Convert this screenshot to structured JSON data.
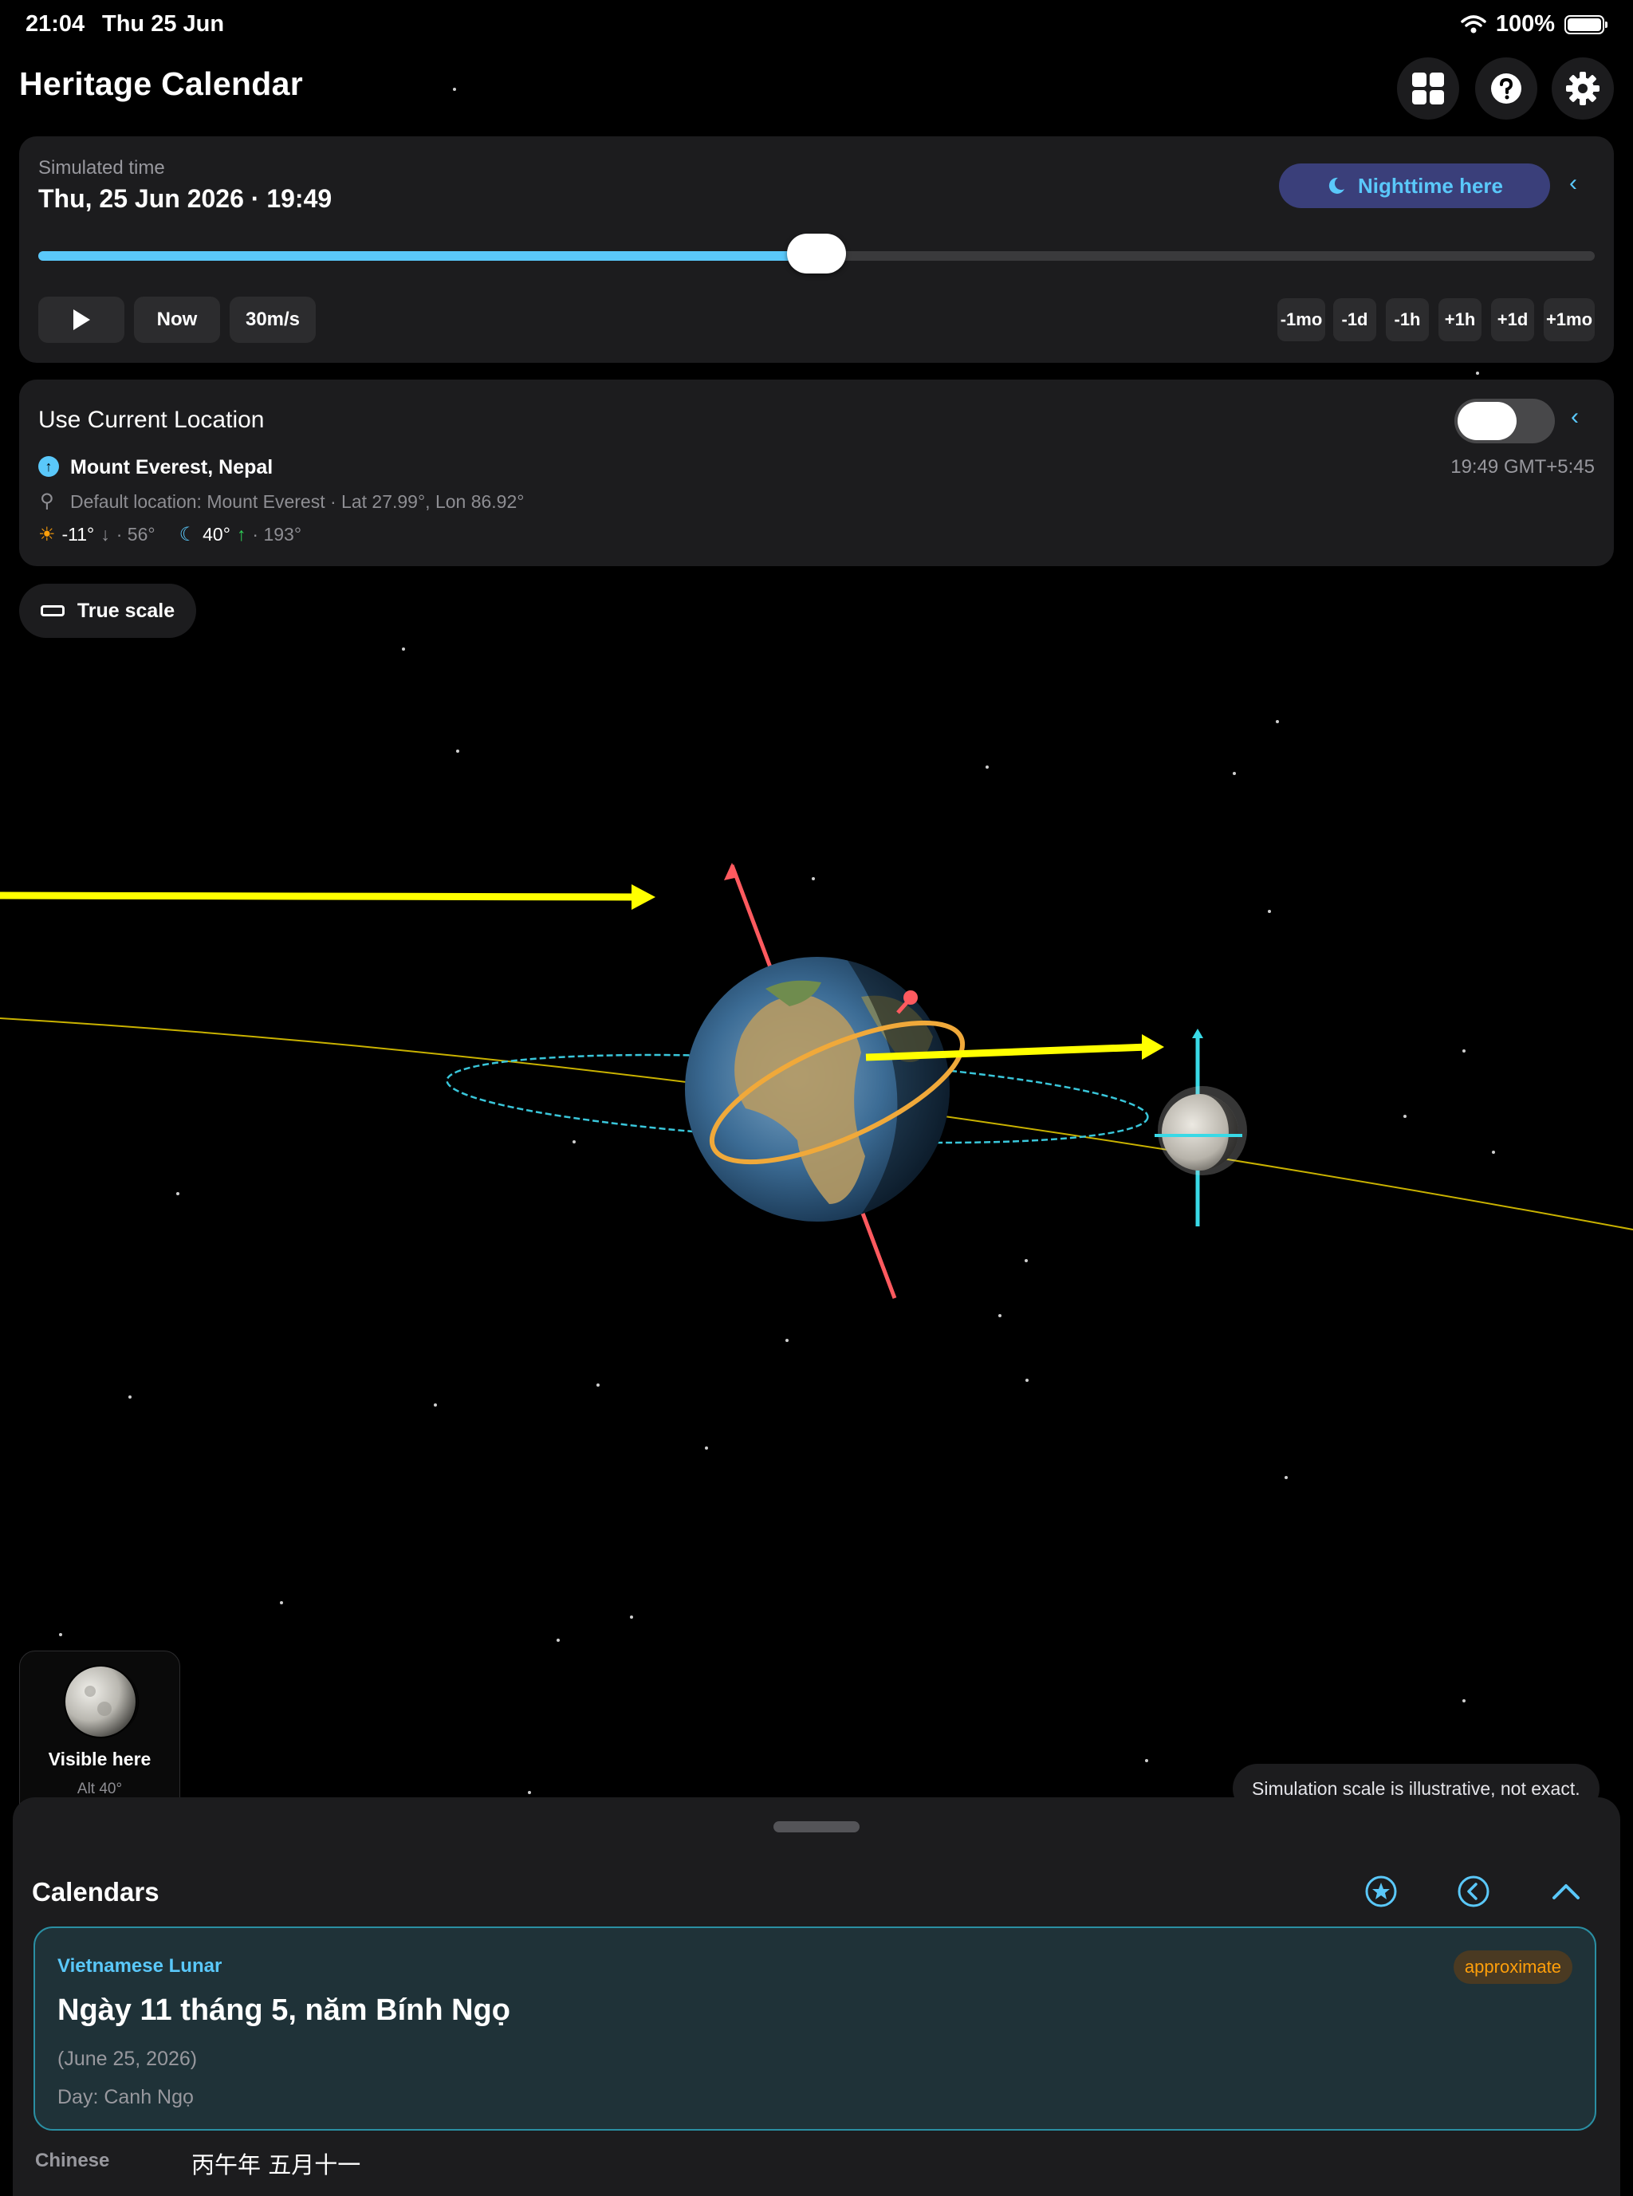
{
  "status_bar": {
    "time": "21:04",
    "date": "Thu 25 Jun",
    "battery": "100%"
  },
  "app": {
    "title": "Heritage Calendar"
  },
  "header_icons": [
    "grid-icon",
    "help-icon",
    "gear-icon"
  ],
  "time_panel": {
    "label": "Simulated time",
    "datetime": "Thu, 25 Jun 2026 · 19:49",
    "night_label": "Nighttime here",
    "slider_fraction": 0.5,
    "controls": {
      "now": "Now",
      "speed": "30m/s"
    },
    "steps": [
      "-1mo",
      "-1d",
      "-1h",
      "+1h",
      "+1d",
      "+1mo"
    ]
  },
  "location_panel": {
    "title": "Use Current Location",
    "toggle_on": false,
    "place": "Mount Everest, Nepal",
    "local_time": "19:49 GMT+5:45",
    "default_text": "Default location: Mount Everest · Lat 27.99°, Lon 86.92°",
    "sun_alt": "-11°",
    "sun_az": "· 56°",
    "moon_alt": "40°",
    "moon_az": "· 193°"
  },
  "true_scale": {
    "label": "True scale"
  },
  "moon_card": {
    "visible_label": "Visible here",
    "alt_label": "Alt 40°"
  },
  "scale_note": "Simulation scale is illustrative, not exact.",
  "calendars": {
    "title": "Calendars",
    "card": {
      "name": "Vietnamese Lunar",
      "badge": "approximate",
      "main": "Ngày 11 tháng 5, năm Bính Ngọ",
      "gregorian": "(June 25, 2026)",
      "day": "Day: Canh Ngọ"
    },
    "next_row": {
      "label": "Chinese",
      "value": "丙午年 五月十一"
    }
  },
  "colors": {
    "accent": "#5ac8fa",
    "sun_arrow": "#ffff00",
    "axis": "#ff5a5f",
    "moon_orbit": "#ff9f0a",
    "badge": "#ff9f0a"
  }
}
